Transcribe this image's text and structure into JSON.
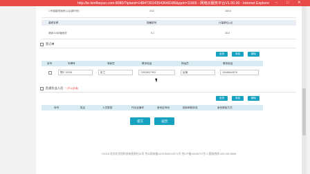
{
  "window": {
    "title": "http://ie.lxmfbeyun.com:8080/?ipland=1484730143543649186&ppln=11665 - 网络云服务平台V1.00.00 - Internet Explorer"
  },
  "top_table": {
    "row1": {
      "c1": "C号楼建筑面积(以后调坏桥)",
      "c2": "4/32",
      "c3": "168.6"
    },
    "header": {
      "c1": "装修名称",
      "c2": "规格型号",
      "c3": "计量单位(㎡)"
    },
    "row2": {
      "c1": "墙体1/4砖墙面漆",
      "c2": "5.1",
      "c3": "38.6"
    }
  },
  "sign_section": {
    "title": "签订单",
    "buttons": {
      "all": "全选",
      "add": "添加",
      "delete": "删除"
    },
    "columns": [
      "序号",
      "车牌号",
      "驾驶员",
      "联系电话",
      "押运员",
      "联系电话"
    ],
    "row": {
      "plate": "鄂E 15208",
      "driver": "彭兰",
      "driver_phone": "13933837993",
      "escort": "赵楠",
      "escort_phone": "15546844578"
    }
  },
  "work_section": {
    "title": "危规作业人员",
    "required_note": "* (不以必填)",
    "buttons": {
      "all": "全选",
      "add": "添加",
      "delete": "删除"
    },
    "columns": [
      "序号",
      "姓名",
      "人员类型",
      "作业证编号",
      "身份证号码",
      "指标审核状态",
      "身份核验方式"
    ]
  },
  "actions": {
    "submit": "提交",
    "back": "返回"
  },
  "footer": {
    "text": "©2016 北京北京思科技有限责任公司   京公网安备11010502013371号   京ICP备16025737号-1   客服热线:400-036-8866"
  }
}
